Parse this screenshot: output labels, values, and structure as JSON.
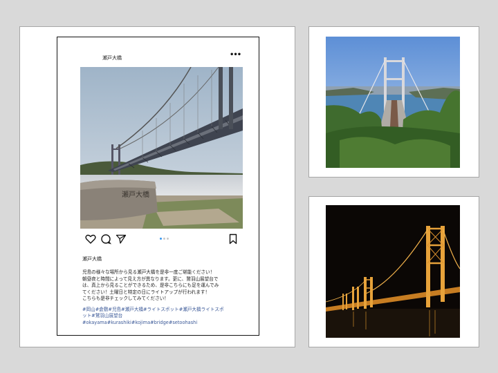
{
  "post": {
    "account": "瀬戸大橋",
    "more": "•••",
    "image_alt": "Seto Ohashi bridge viewed from below with stone monument",
    "monument_text": "瀬戸大橋",
    "carousel": {
      "count": 3,
      "active": 1
    },
    "caption_title": "瀬戸大橋",
    "caption_body": "児島の様々な場所から見る瀬戸大橋を是非一度ご堪能ください！\n朝昼夜と時間によって見え方が異なります。更に、鷲羽山展望台で\nは、真上から見ることができるため、是非こちらにも足を運んでみ\nてください！土曜日と特定の日にライトアップが行われます！\nこちらも是非チェックしてみてください！",
    "hashtags": "#岡山#倉敷#児島#瀬戸大橋#ライトスポット#瀬戸大橋ライトスポ\nット#鷲羽山展望台\n#okayama#kurashiki#kojima#bridge#setoohashi"
  },
  "icons": {
    "like": "heart-icon",
    "comment": "comment-icon",
    "share": "send-icon",
    "save": "bookmark-icon"
  },
  "colors": {
    "hashtag": "#3b5998",
    "dot_active": "#3897f0"
  }
}
